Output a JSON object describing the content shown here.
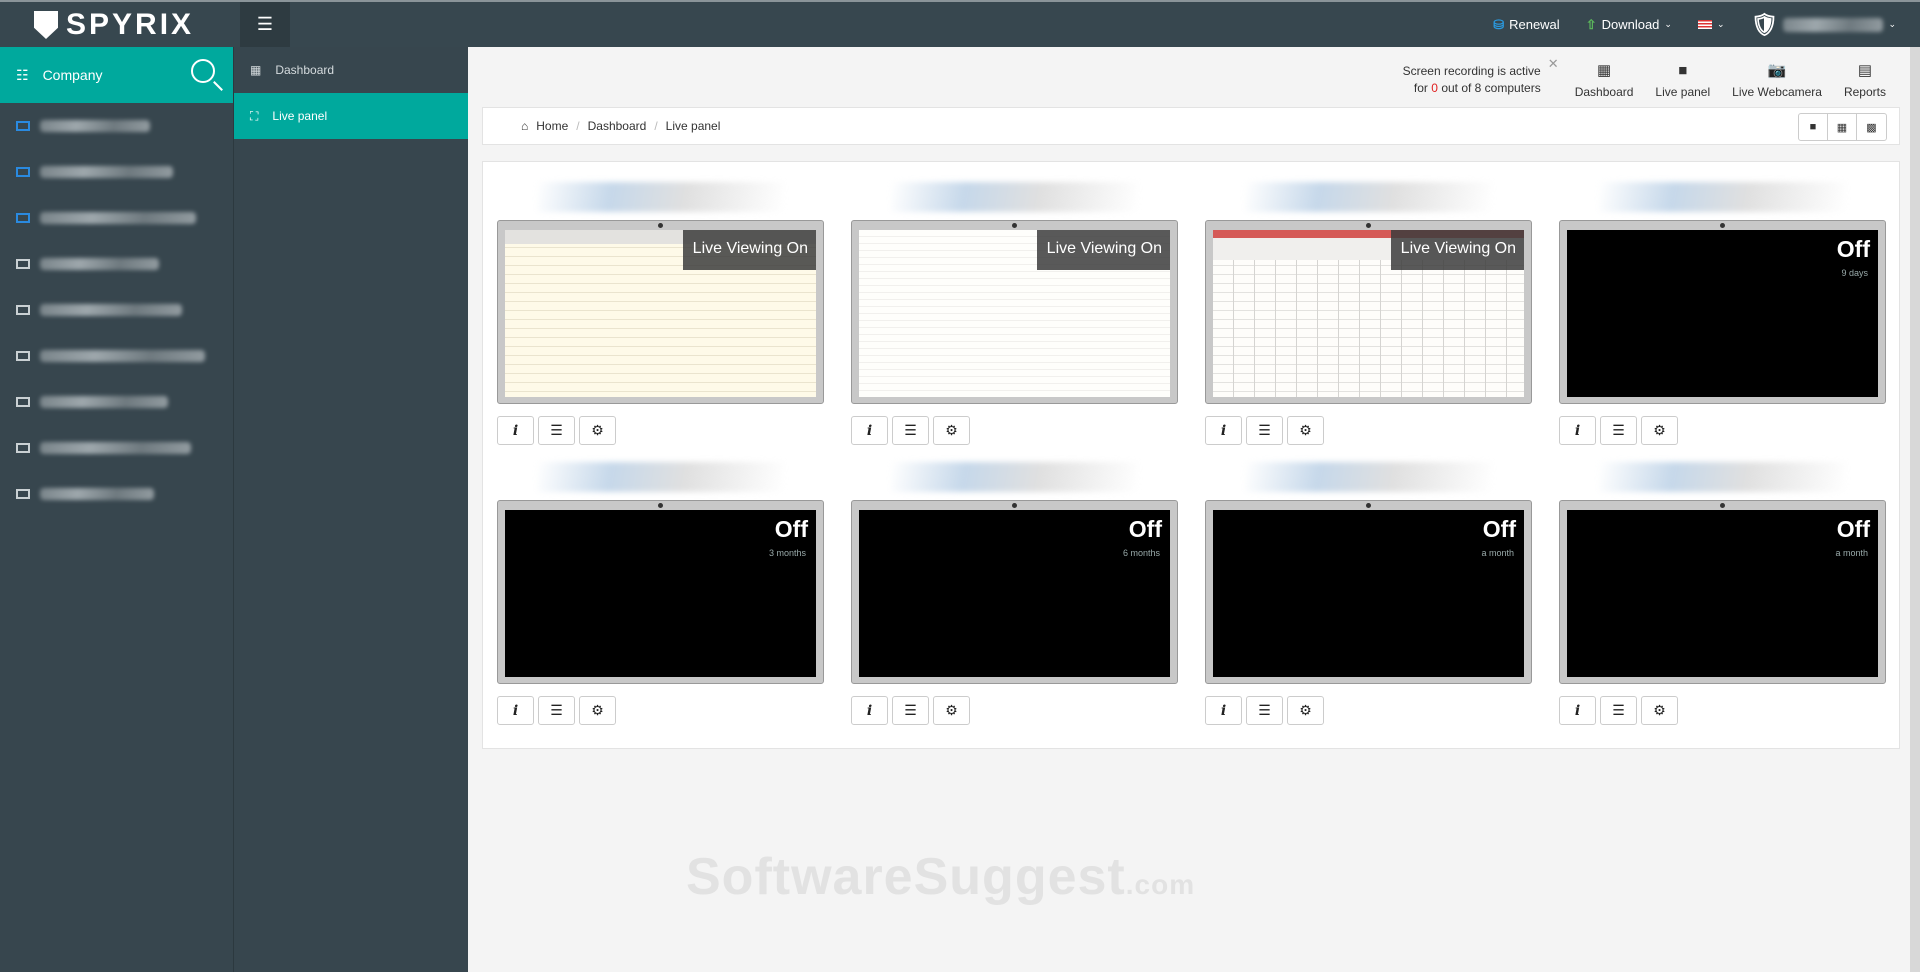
{
  "brand": {
    "name": "SPYRIX",
    "accent": "#00a99d",
    "topbar": "#37474f"
  },
  "topbar": {
    "renewal": "Renewal",
    "download": "Download"
  },
  "sidebar": {
    "company": "Company",
    "computer_count": 9
  },
  "nav": {
    "items": [
      {
        "label": "Dashboard",
        "icon": "grid-icon"
      },
      {
        "label": "Live panel",
        "icon": "expand-icon",
        "active": true
      }
    ]
  },
  "header": {
    "rec_line1": "Screen recording is active",
    "rec_for": "for",
    "rec_count": "0",
    "rec_rest": "out of 8 computers",
    "buttons": [
      {
        "label": "Dashboard",
        "icon": "grid-icon"
      },
      {
        "label": "Live panel",
        "icon": "video-icon"
      },
      {
        "label": "Live Webcamera",
        "icon": "camera-icon"
      },
      {
        "label": "Reports",
        "icon": "report-icon"
      }
    ]
  },
  "breadcrumb": [
    "Home",
    "Dashboard",
    "Live panel"
  ],
  "cards": [
    {
      "status": "Live Viewing On",
      "ago": "",
      "screen": "t"
    },
    {
      "status": "Live Viewing On",
      "ago": "",
      "screen": ""
    },
    {
      "status": "Live Viewing On",
      "ago": "",
      "screen": "x"
    },
    {
      "status": "Off",
      "ago": "9 days"
    },
    {
      "status": "Off",
      "ago": "3 months"
    },
    {
      "status": "Off",
      "ago": "6 months"
    },
    {
      "status": "Off",
      "ago": "a month"
    },
    {
      "status": "Off",
      "ago": "a month"
    }
  ],
  "watermark": {
    "main": "SoftwareSuggest",
    "suffix": ".com"
  }
}
